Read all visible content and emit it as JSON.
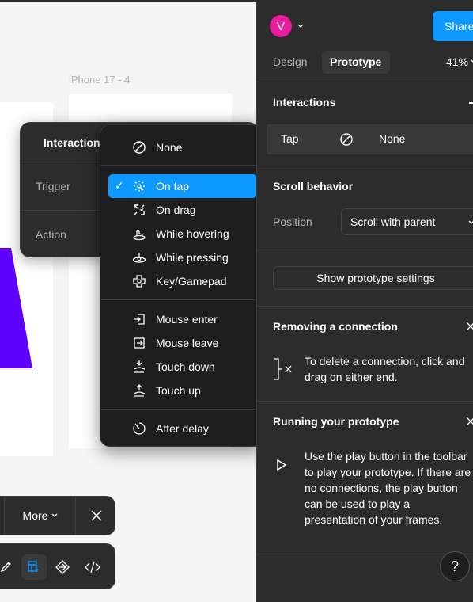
{
  "canvas": {
    "frame_label": "iPhone 17 - 4",
    "accent_purple": "#6000ff"
  },
  "interaction_popup": {
    "title": "Interaction",
    "trigger_label": "Trigger",
    "action_label": "Action"
  },
  "trigger_menu": {
    "groups": [
      [
        {
          "label": "None",
          "icon": "none-icon"
        }
      ],
      [
        {
          "label": "On tap",
          "icon": "tap-icon",
          "selected": true
        },
        {
          "label": "On drag",
          "icon": "drag-icon"
        },
        {
          "label": "While hovering",
          "icon": "hover-icon"
        },
        {
          "label": "While pressing",
          "icon": "press-icon"
        },
        {
          "label": "Key/Gamepad",
          "icon": "gamepad-icon"
        }
      ],
      [
        {
          "label": "Mouse enter",
          "icon": "mouse-enter-icon"
        },
        {
          "label": "Mouse leave",
          "icon": "mouse-leave-icon"
        },
        {
          "label": "Touch down",
          "icon": "touch-down-icon"
        },
        {
          "label": "Touch up",
          "icon": "touch-up-icon"
        }
      ],
      [
        {
          "label": "After delay",
          "icon": "delay-icon"
        }
      ]
    ],
    "checkmark": "✓",
    "selected_color": "#0d99ff"
  },
  "toolbar": {
    "more_label": "More",
    "close_icon": "close-icon",
    "tools": [
      "pen-icon",
      "prototype-icon",
      "component-icon",
      "code-icon"
    ]
  },
  "panel": {
    "avatar_letter": "V",
    "avatar_color": "#e91e9f",
    "share_label": "Share",
    "tabs": [
      "Design",
      "Prototype"
    ],
    "zoom": "41%",
    "interactions": {
      "title": "Interactions",
      "row_trigger": "Tap",
      "row_action": "None"
    },
    "scroll": {
      "title": "Scroll behavior",
      "position_label": "Position",
      "position_value": "Scroll with parent"
    },
    "settings_button": "Show prototype settings",
    "removing": {
      "title": "Removing a connection",
      "text": "To delete a connection, click and drag on either end."
    },
    "running": {
      "title": "Running your prototype",
      "text": "Use the play button in the toolbar to play your prototype. If there are no connections, the play button can be used to play a presentation of your frames."
    },
    "help": "?"
  }
}
